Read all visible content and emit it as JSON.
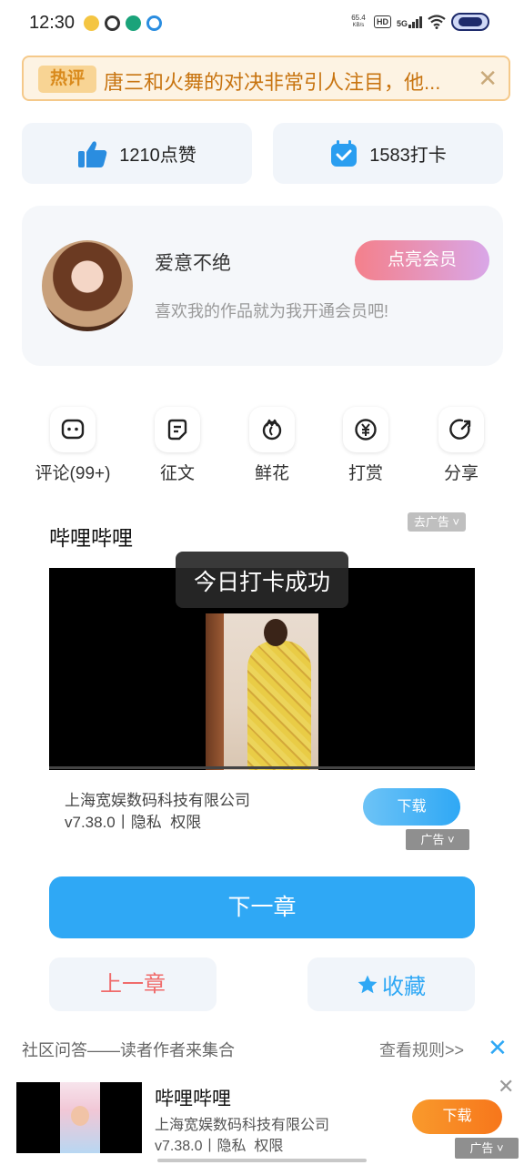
{
  "status_bar": {
    "time": "12:30",
    "net_speed_value": "65.4",
    "net_speed_unit": "KB/s",
    "hd": "HD",
    "network": "5G"
  },
  "hot_banner": {
    "tag": "热评",
    "text": "唐三和火舞的对决非常引人注目，他...",
    "close": "✕"
  },
  "stats": {
    "likes": "1210点赞",
    "checkins": "1583打卡"
  },
  "author": {
    "name": "爱意不绝",
    "description": "喜欢我的作品就为我开通会员吧!",
    "vip_button": "点亮会员"
  },
  "actions": [
    {
      "label": "评论(99+)",
      "icon": "comment-icon"
    },
    {
      "label": "征文",
      "icon": "essay-icon"
    },
    {
      "label": "鲜花",
      "icon": "flower-icon"
    },
    {
      "label": "打赏",
      "icon": "reward-icon"
    },
    {
      "label": "分享",
      "icon": "share-icon"
    }
  ],
  "ad": {
    "title": "哔哩哔哩",
    "remove_ad": "去广告 ˅",
    "toast": "今日打卡成功",
    "company": "上海宽娱数码科技有限公司",
    "version_line": "v7.38.0丨隐私  权限",
    "download": "下载",
    "ad_label": "广告 ˅"
  },
  "chapter_nav": {
    "next": "下一章",
    "prev": "上一章",
    "favorite": "收藏"
  },
  "community": {
    "text": "社区问答——读者作者来集合",
    "rules": "查看规则>>",
    "close": "✕"
  },
  "bottom_ad": {
    "title": "哔哩哔哩",
    "company": "上海宽娱数码科技有限公司",
    "version_line": "v7.38.0丨隐私  权限",
    "download": "下载",
    "close": "✕",
    "ad_label": "广告 ˅"
  },
  "colors": {
    "accent_blue": "#2fa8f5",
    "prev_red": "#f06b6b",
    "hot_orange": "#c87410",
    "download_orange": "#f7761b"
  }
}
